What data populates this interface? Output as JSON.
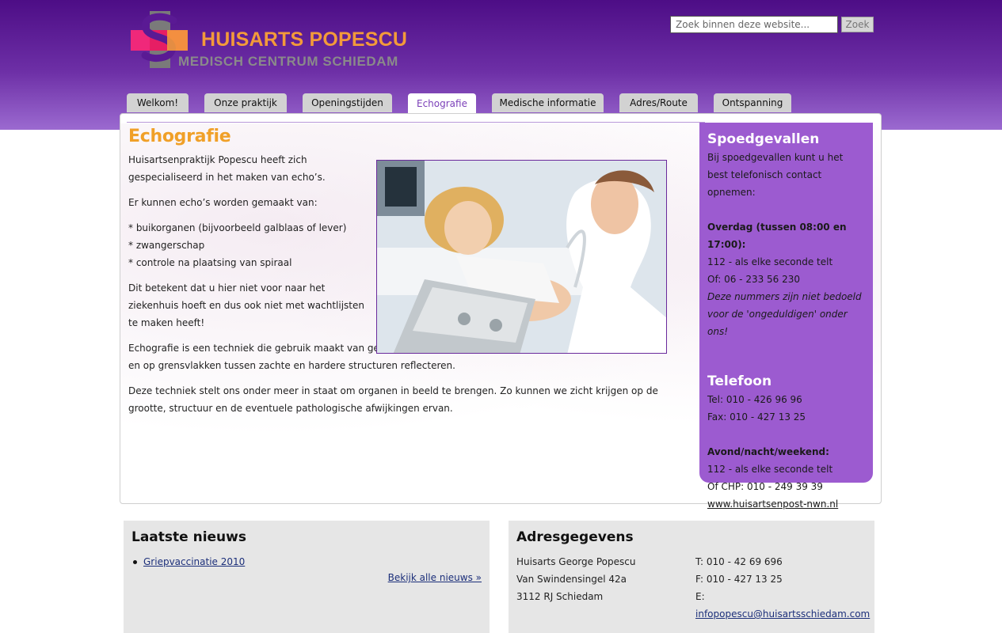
{
  "header": {
    "logo_title": "HUISARTS POPESCU",
    "logo_subtitle": "MEDISCH CENTRUM SCHIEDAM",
    "search_placeholder": "Zoek binnen deze website...",
    "search_button": "Zoek"
  },
  "nav": {
    "tabs": [
      {
        "label": "Welkom!"
      },
      {
        "label": "Onze praktijk"
      },
      {
        "label": "Openingstijden"
      },
      {
        "label": "Echografie"
      },
      {
        "label": "Medische informatie"
      },
      {
        "label": "Adres/Route"
      },
      {
        "label": "Ontspanning"
      }
    ],
    "active": "Echografie"
  },
  "main": {
    "title": "Echografie",
    "paragraphs": [
      "Huisartsenpraktijk Popescu heeft zich gespecialiseerd in het maken van echo’s.",
      "Er kunnen echo’s worden gemaakt van:",
      "* buikorganen (bijvoorbeeld galblaas of lever)",
      "* zwangerschap",
      "* controle na plaatsing van spiraal",
      "Dit betekent dat u hier niet voor naar het ziekenhuis hoeft en dus ook niet met wachtlijsten te maken heeft!",
      "Echografie is een techniek die gebruik maakt van geluidsgolven die zich door het lichaam verplaatsen en op grensvlakken tussen zachte en hardere structuren reflecteren.",
      "Deze techniek stelt ons onder meer in staat om organen in beeld te brengen. Zo kunnen we zicht krijgen op de grootte, structuur en de eventuele pathologische afwijkingen ervan."
    ]
  },
  "sidebar": {
    "spoed_title": "Spoedgevallen",
    "spoed_intro": "Bij spoedgevallen kunt u het best telefonisch contact opnemen:",
    "overdag_label": "Overdag (tussen 08:00 en 17:00):",
    "overdag_line1": "112 - als elke seconde telt",
    "overdag_line2": "Of: 06 - 233 56 230",
    "overdag_note": "Deze nummers zijn niet bedoeld voor de 'ongeduldigen' onder ons!",
    "telefoon_title": "Telefoon",
    "tel": "Tel: 010 - 426 96 96",
    "fax": "Fax: 010 - 427 13 25",
    "avond_label": "Avond/nacht/weekend:",
    "avond_line1": "112 - als elke seconde telt",
    "avond_line2": "Of CHP: 010 - 249 39 39",
    "avond_link": "www.huisartsenpost-nwn.nl"
  },
  "news": {
    "title": "Laatste nieuws",
    "items": [
      "Griepvaccinatie 2010"
    ],
    "all_link": "Bekijk alle nieuws »"
  },
  "address": {
    "title": "Adresgegevens",
    "name": "Huisarts George Popescu",
    "street": "Van Swindensingel 42a",
    "city": "3112 RJ Schiedam",
    "phone": "T: 010 - 42 69 696",
    "fax": "F: 010 - 427 13 25",
    "email_prefix": "E: ",
    "email": "infopopescu@huisartsschiedam.com"
  },
  "colors": {
    "header_purple": "#5a1a94",
    "accent_orange": "#f0a028",
    "sidebar_purple": "#9c5bd0",
    "tab_active_text": "#7b3fb8"
  }
}
